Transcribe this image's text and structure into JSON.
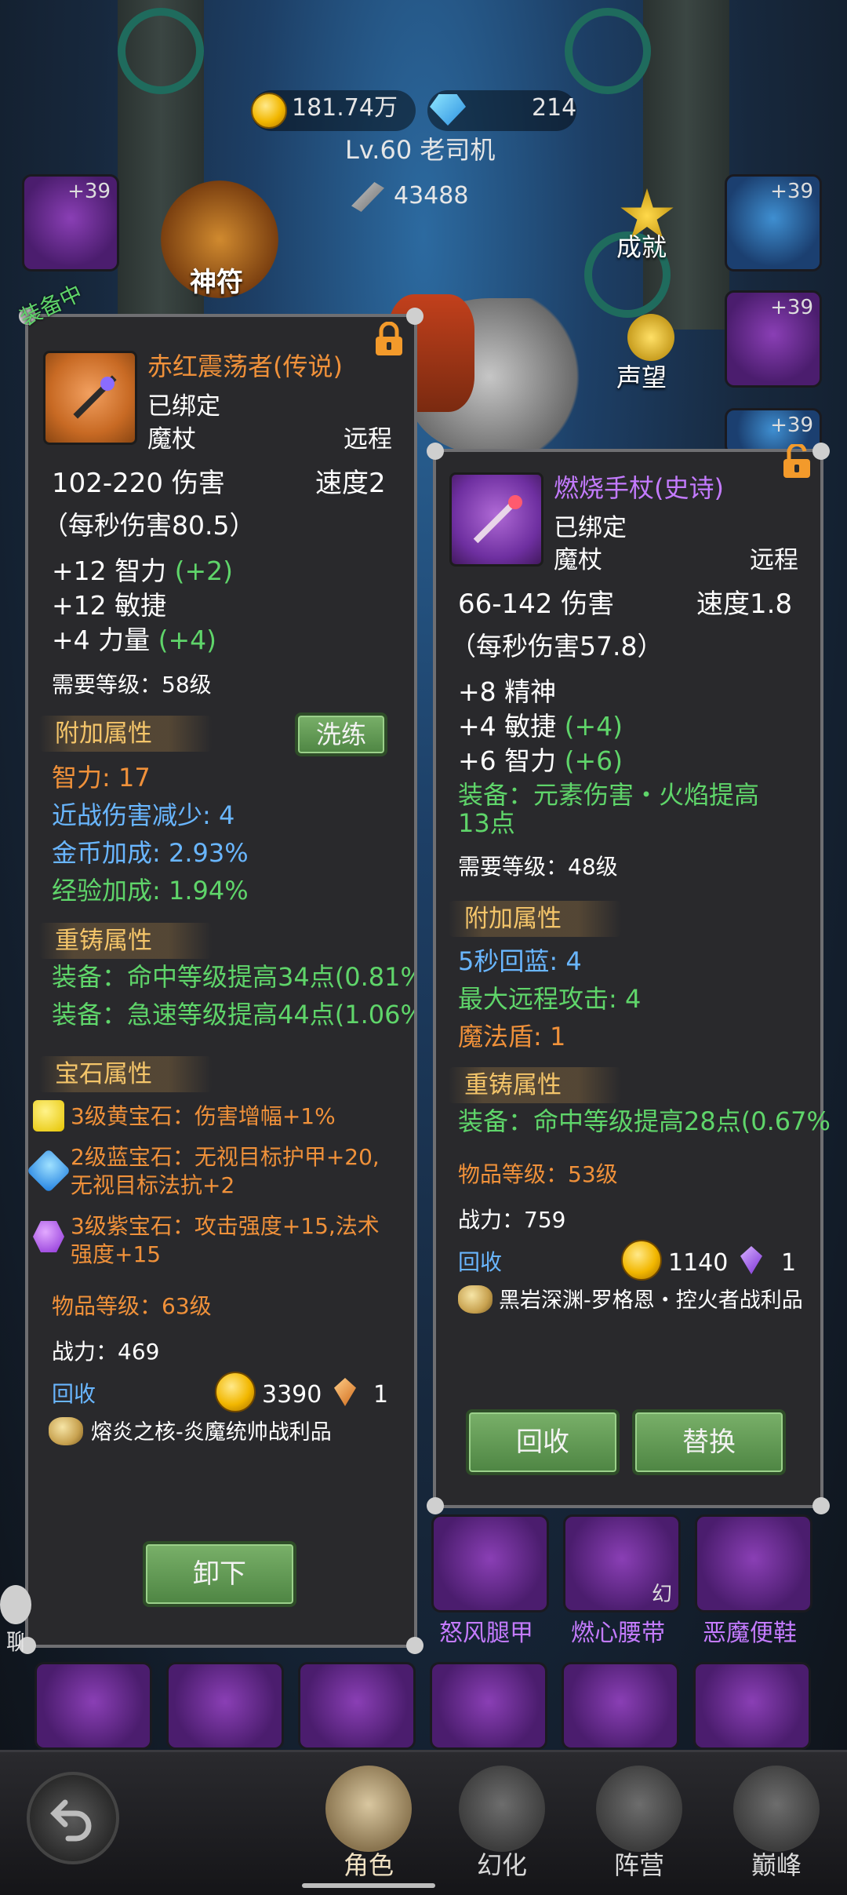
{
  "hud": {
    "gold": "181.74万",
    "gems": "214",
    "player": "Lv.60 老司机",
    "power": "43488",
    "side_labels": [
      "神符",
      "成就",
      "声望"
    ],
    "equipped_tag": "装备中"
  },
  "slots_top": [
    "+39",
    "+39",
    "+39",
    "+39"
  ],
  "left_card": {
    "name": "赤红震荡者(传说)",
    "bound": "已绑定",
    "type": "魔杖",
    "range": "远程",
    "damage": "102-220 伤害",
    "speed": "速度2",
    "dps": "（每秒伤害80.5）",
    "stats": [
      {
        "base": "+12 智力",
        "bonus": "(+2)"
      },
      {
        "base": "+12 敏捷",
        "bonus": ""
      },
      {
        "base": "+4 力量",
        "bonus": "(+4)"
      }
    ],
    "req_level": "需要等级：58级",
    "extra_title": "附加属性",
    "reroll_label": "洗练",
    "extra": [
      {
        "text": "智力: 17",
        "color": "orange"
      },
      {
        "text": "近战伤害减少: 4",
        "color": "blue"
      },
      {
        "text": "金币加成: 2.93%",
        "color": "blue"
      },
      {
        "text": "经验加成: 1.94%",
        "color": "green"
      }
    ],
    "reforge_title": "重铸属性",
    "reforge": [
      "装备：命中等级提高34点(0.81%",
      "装备：急速等级提高44点(1.06%"
    ],
    "gem_title": "宝石属性",
    "gems": [
      {
        "icon": "yellow-gem-icon",
        "lines": [
          "3级黄宝石：伤害增幅+1%"
        ],
        "color": "#f1d83a"
      },
      {
        "icon": "blue-gem-icon",
        "lines": [
          "2级蓝宝石：无视目标护甲+20,",
          "无视目标法抗+2"
        ],
        "color": "#3aa3f1"
      },
      {
        "icon": "purple-gem-icon",
        "lines": [
          "3级紫宝石：攻击强度+15,法术",
          "强度+15"
        ],
        "color": "#b25ef0"
      }
    ],
    "item_level": "物品等级：63级",
    "power": "战力：469",
    "recycle": "回收",
    "coin_value": "3390",
    "shard_value": "1",
    "source": "熔炎之核-炎魔统帅战利品",
    "unequip": "卸下"
  },
  "right_card": {
    "name": "燃烧手杖(史诗)",
    "bound": "已绑定",
    "type": "魔杖",
    "range": "远程",
    "damage": "66-142 伤害",
    "speed": "速度1.8",
    "dps": "（每秒伤害57.8）",
    "stats": [
      {
        "base": "+8 精神",
        "bonus": ""
      },
      {
        "base": "+4 敏捷",
        "bonus": "(+4)"
      },
      {
        "base": "+6 智力",
        "bonus": "(+6)"
      }
    ],
    "equip_effect": [
      "装备：元素伤害・火焰提高",
      "13点"
    ],
    "req_level": "需要等级：48级",
    "extra_title": "附加属性",
    "extra": [
      {
        "text": "5秒回蓝: 4",
        "color": "blue"
      },
      {
        "text": "最大远程攻击: 4",
        "color": "green"
      },
      {
        "text": "魔法盾: 1",
        "color": "orange"
      }
    ],
    "reforge_title": "重铸属性",
    "reforge": [
      "装备：命中等级提高28点(0.67%"
    ],
    "item_level": "物品等级：53级",
    "power": "战力：759",
    "recycle": "回收",
    "coin_value": "1140",
    "shard_value": "1",
    "source": "黑岩深渊-罗格恩・控火者战利品",
    "btn_recycle": "回收",
    "btn_replace": "替换"
  },
  "bag_items": [
    "怒风腿甲",
    "燃心腰带",
    "恶魔便鞋"
  ],
  "bag_badge": "幻",
  "chat_label": "聊天",
  "nav": [
    "角色",
    "幻化",
    "阵营",
    "巅峰"
  ]
}
